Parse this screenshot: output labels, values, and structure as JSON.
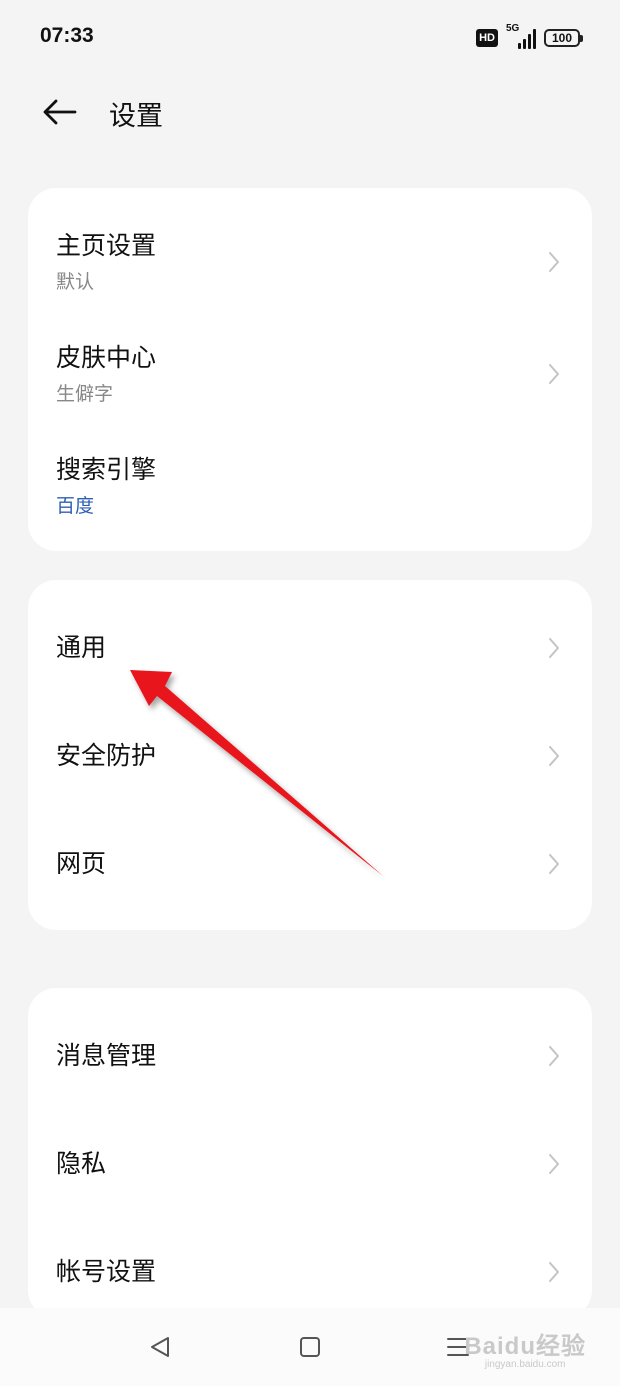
{
  "status_bar": {
    "time": "07:33",
    "hd": "HD",
    "network": "5G",
    "battery": "100"
  },
  "header": {
    "title": "设置",
    "back_icon": "arrow-left-icon"
  },
  "sections": [
    {
      "items": [
        {
          "title": "主页设置",
          "subtitle": "默认"
        },
        {
          "title": "皮肤中心",
          "subtitle": "生僻字"
        },
        {
          "title": "搜索引擎",
          "subtitle": "百度"
        }
      ]
    },
    {
      "items": [
        {
          "title": "通用"
        },
        {
          "title": "安全防护"
        },
        {
          "title": "网页"
        }
      ]
    },
    {
      "items": [
        {
          "title": "消息管理"
        },
        {
          "title": "隐私"
        },
        {
          "title": "帐号设置"
        }
      ]
    }
  ],
  "colors": {
    "background": "#f4f4f4",
    "card": "#ffffff",
    "subtitle": "#888888",
    "link_subtitle": "#2f5fb3",
    "annotation_arrow": "#e8141b"
  },
  "watermark": {
    "logo": "Baidu经验",
    "url": "jingyan.baidu.com"
  }
}
